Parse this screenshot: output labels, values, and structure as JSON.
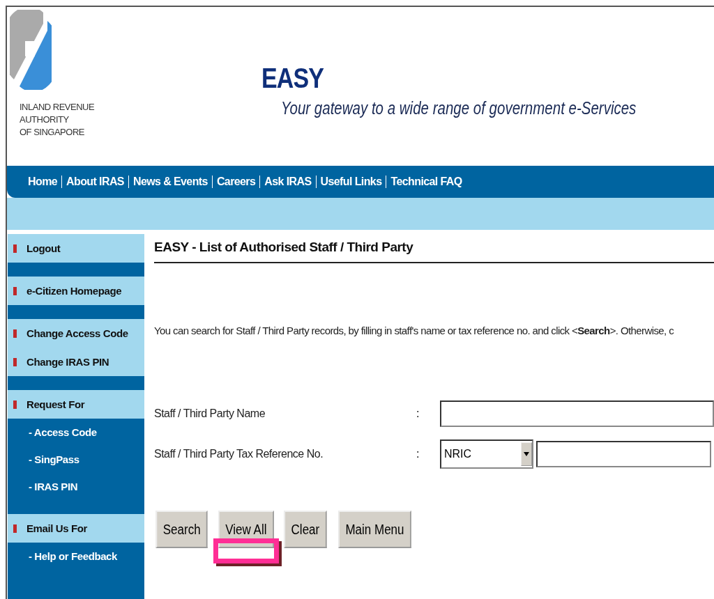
{
  "header": {
    "logo_lines": [
      "INLAND REVENUE",
      "AUTHORITY",
      "OF SINGAPORE"
    ],
    "title": "EASY",
    "tagline": "Your gateway to a wide range of government e-Services"
  },
  "nav": [
    "Home",
    "About IRAS",
    "News & Events",
    "Careers",
    "Ask IRAS",
    "Useful Links",
    "Technical FAQ"
  ],
  "sidebar": {
    "groups": [
      {
        "items": [
          {
            "label": "Logout",
            "kind": "main"
          }
        ]
      },
      {
        "items": [
          {
            "label": "e-Citizen Homepage",
            "kind": "main"
          }
        ]
      },
      {
        "items": [
          {
            "label": "Change Access Code",
            "kind": "main"
          },
          {
            "label": "Change IRAS PIN",
            "kind": "main"
          }
        ]
      },
      {
        "items": [
          {
            "label": "Request For",
            "kind": "main"
          },
          {
            "label": "- Access Code",
            "kind": "sub"
          },
          {
            "label": "- SingPass",
            "kind": "sub"
          },
          {
            "label": "- IRAS PIN",
            "kind": "sub"
          }
        ]
      },
      {
        "items": [
          {
            "label": "Email Us For",
            "kind": "main"
          },
          {
            "label": "- Help or Feedback",
            "kind": "sub"
          }
        ]
      }
    ]
  },
  "main": {
    "heading": "EASY - List of Authorised Staff / Third Party",
    "instruction": "You can search for Staff / Third Party records, by filling in staff's name or tax reference no. and click <**Search**>. Otherwise, c",
    "fields": [
      {
        "label": "Staff / Third Party Name",
        "separator": ":",
        "kind": "text"
      },
      {
        "label": "Staff / Third Party Tax Reference No.",
        "separator": ":",
        "kind": "select-text",
        "select_value": "NRIC"
      }
    ],
    "buttons": [
      {
        "label": "Search",
        "highlighted": false
      },
      {
        "label": "View All",
        "highlighted": true
      },
      {
        "label": "Clear",
        "highlighted": false
      },
      {
        "label": "Main Menu",
        "highlighted": false
      }
    ]
  }
}
